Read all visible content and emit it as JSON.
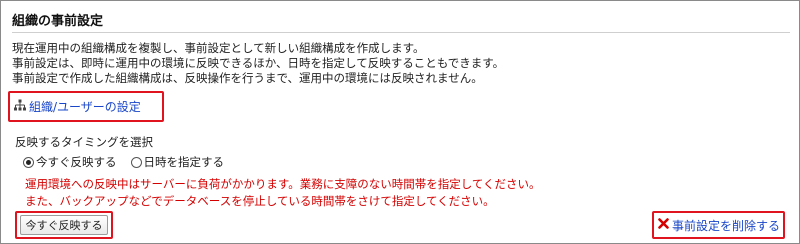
{
  "header": {
    "title": "組織の事前設定"
  },
  "description": [
    "現在運用中の組織構成を複製し、事前設定として新しい組織構成を作成します。",
    "事前設定は、即時に運用中の環境に反映できるほか、日時を指定して反映することもできます。",
    "事前設定で作成した組織構成は、反映操作を行うまで、運用中の環境には反映されません。"
  ],
  "org_link": {
    "label": "組織/ユーザーの設定",
    "icon": "org-tree-icon"
  },
  "timing": {
    "label": "反映するタイミングを選択",
    "options": [
      {
        "label": "今すぐ反映する",
        "selected": true
      },
      {
        "label": "日時を指定する",
        "selected": false
      }
    ]
  },
  "warnings": [
    "運用環境への反映中はサーバーに負荷がかかります。業務に支障のない時間帯を指定してください。",
    "また、バックアップなどでデータベースを停止している時間帯をさけて指定してください。"
  ],
  "apply_button": {
    "label": "今すぐ反映する"
  },
  "delete_link": {
    "label": "事前設定を削除する",
    "icon": "close-x-icon"
  },
  "colors": {
    "link": "#1a47c8",
    "warning": "#d40000",
    "highlight": "#e0141e"
  }
}
